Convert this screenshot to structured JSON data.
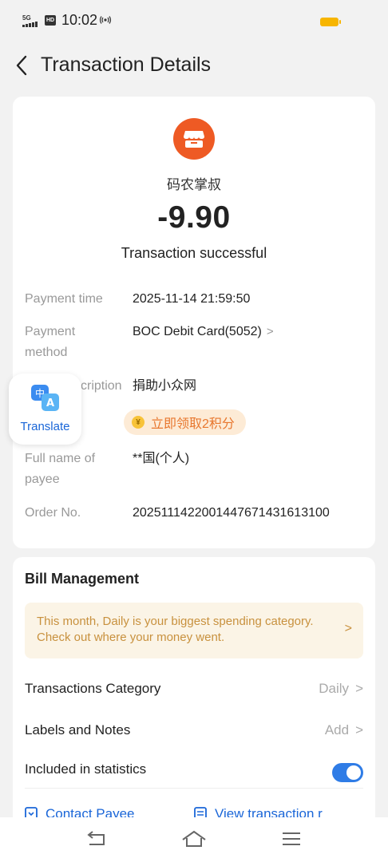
{
  "status_bar": {
    "network": "5G",
    "hd": "HD",
    "time": "10:02",
    "nfc": "(((",
    "battery_color": "#f7b500"
  },
  "header": {
    "back_icon": "chevron-left-icon",
    "title": "Transaction Details"
  },
  "merchant": {
    "icon": "store-icon",
    "icon_color": "#ee5a24",
    "name": "码农掌叔"
  },
  "amount": "-9.90",
  "status": "Transaction successful",
  "details": [
    {
      "label": "Payment time",
      "value": "2025-11-14 21:59:50"
    },
    {
      "label": "Payment method",
      "value": "BOC Debit Card(5052)"
    },
    {
      "label": "Description",
      "value": "捐助小众网"
    },
    {
      "label": "Full name of payee",
      "value": "**国(个人)"
    },
    {
      "label": "Order No.",
      "value": "2025111422001447671431613100"
    }
  ],
  "description_label_visible": "cription",
  "points_pill": {
    "coin": "¥",
    "label": "立即领取2积分"
  },
  "translate_button": {
    "icon": "translate-icon",
    "label": "Translate"
  },
  "bill_management": {
    "title": "Bill Management",
    "banner_text": "This month, Daily is your biggest spending category. Check out where your money went.",
    "rows": [
      {
        "label": "Transactions Category",
        "value": "Daily"
      },
      {
        "label": "Labels and Notes",
        "value": "Add"
      },
      {
        "label": "Included in statistics",
        "toggle_on": true
      }
    ],
    "actions": [
      {
        "icon": "contact-icon",
        "label": "Contact Payee"
      },
      {
        "icon": "document-icon",
        "label": "View transaction r"
      }
    ]
  },
  "nav_bar": {
    "back": "back-nav-icon",
    "home": "home-nav-icon",
    "menu": "menu-nav-icon"
  },
  "colors": {
    "accent_blue": "#1a66d8",
    "toggle_blue": "#2f7ce6",
    "banner_text": "#c8913e",
    "points_text": "#e8772e"
  }
}
